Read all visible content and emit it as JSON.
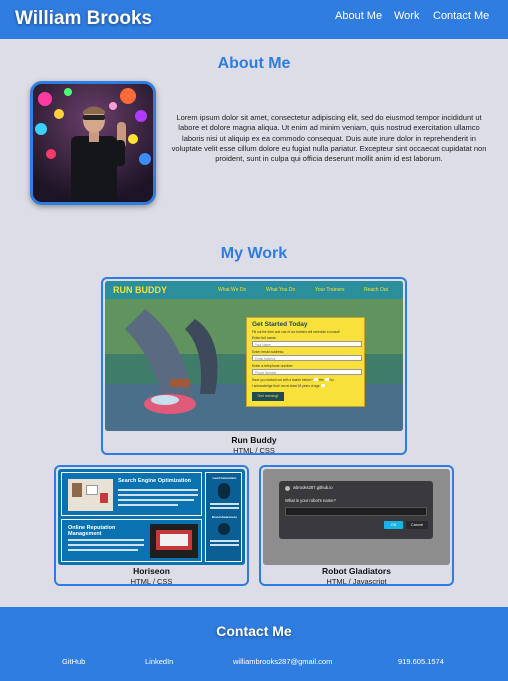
{
  "header": {
    "name": "William Brooks",
    "nav": [
      "About Me",
      "Work",
      "Contact Me"
    ]
  },
  "about": {
    "title": "About Me",
    "text": "Lorem ipsum dolor sit amet, consectetur adipiscing elit, sed do eiusmod tempor incididunt ut labore et dolore magna aliqua. Ut enim ad minim veniam, quis nostrud exercitation ullamco laboris nisi ut aliquip ex ea commodo consequat. Duis aute irure dolor in reprehenderit in voluptate velit esse cillum dolore eu fugiat nulla pariatur. Excepteur sint occaecat cupidatat non proident, sunt in culpa qui officia deserunt mollit anim id est laborum."
  },
  "work": {
    "title": "My Work",
    "projects": [
      {
        "title": "Run Buddy",
        "tech": "HTML / CSS",
        "preview": {
          "brand": "RUN BUDDY",
          "nav": [
            "What We Do",
            "What You Do",
            "Your Trainers",
            "Reach Out"
          ],
          "form_title": "Get Started Today",
          "form_sub": "Fill out the form and one of our trainers will schedule a consult",
          "fields": [
            "Enter full name:",
            "Enter email address:",
            "Enter a telephone number:"
          ],
          "placeholders": [
            "Your Name",
            "Email Address",
            "Phone Number"
          ],
          "question": "Have you worked out with a trainer before?",
          "yes": "Yes",
          "no": "No",
          "ack": "I acknowledge that I am at least 18 years of age",
          "button": "Get running!"
        }
      },
      {
        "title": "Horiseon",
        "tech": "HTML / CSS",
        "preview": {
          "heading1": "Search Engine Optimization",
          "heading2": "Online Reputation Management",
          "side1": "Lead Generation",
          "side2": "Brand Awareness"
        }
      },
      {
        "title": "Robot Gladiators",
        "tech": "HTML / Javascript",
        "preview": {
          "site": "wbrooks287.github.io",
          "prompt": "What is your robot's name?",
          "ok": "OK",
          "cancel": "Cancel"
        }
      }
    ]
  },
  "contact": {
    "title": "Contact Me",
    "links": [
      "GitHub",
      "LinkedIn",
      "williambrooks287@gmail.com",
      "919.605.1574"
    ]
  },
  "colors": {
    "accent": "#2f7de1",
    "background": "#dcdde6"
  }
}
